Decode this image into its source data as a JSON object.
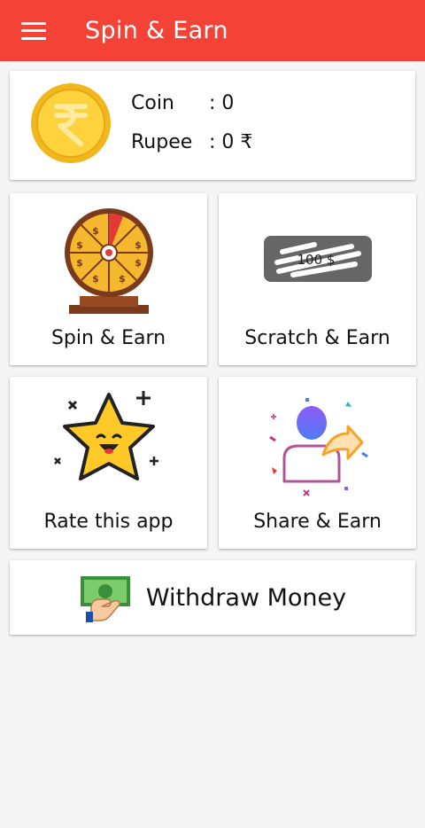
{
  "app": {
    "title": "Spin & Earn",
    "accent_color": "#f44336"
  },
  "balance": {
    "coin_label": "Coin",
    "coin_value": ": 0",
    "rupee_label": "Rupee",
    "rupee_value": ": 0 ₹",
    "coin_icon": "rupee-coin-icon"
  },
  "tiles": [
    {
      "label": "Spin & Earn",
      "icon": "spin-wheel-icon"
    },
    {
      "label": "Scratch & Earn",
      "icon": "scratch-card-icon",
      "icon_text": "100 $"
    },
    {
      "label": "Rate this app",
      "icon": "smiling-star-icon"
    },
    {
      "label": "Share & Earn",
      "icon": "share-user-icon"
    }
  ],
  "withdraw": {
    "label": "Withdraw Money",
    "icon": "cash-hand-icon"
  }
}
